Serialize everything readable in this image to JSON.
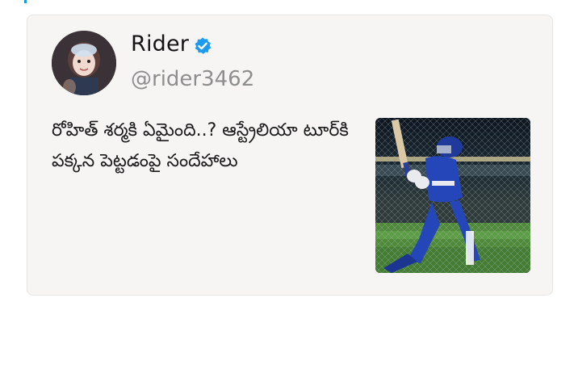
{
  "accent_color": "#1a9bd7",
  "card": {
    "background": "#f6f5f4",
    "author": {
      "name": "Rider",
      "handle": "@rider3462",
      "verified": true,
      "verified_icon": "verified-badge-icon",
      "verified_color": "#1d9bf0",
      "avatar_icon": "profile-photo"
    },
    "text": "రోహిత్ శర్మకి ఏమైంది..? ఆస్ట్రేలియా టూర్‌కి పక్కన పెట్టడంపై సందేహాలు",
    "thumbnail": "cricket-batsman-photo"
  }
}
